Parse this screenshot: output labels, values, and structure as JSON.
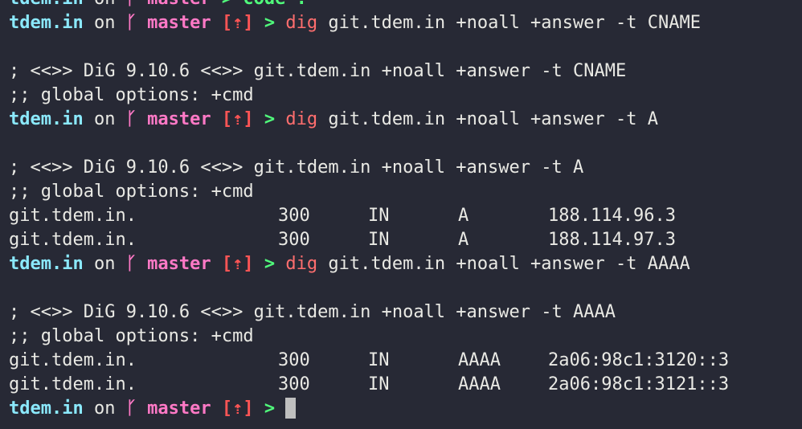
{
  "prompt": {
    "host": "tdem.in",
    "on": "on",
    "branch_icon": "git-branch-icon",
    "branch_glyph": "ᚴ",
    "branch": "master",
    "status": "[⇡]",
    "arrow": ">"
  },
  "top_partial": {
    "host": "tdem.in",
    "on": "on",
    "branch": "master",
    "rest": "> code ."
  },
  "commands": [
    {
      "cmd": "dig",
      "args": " git.tdem.in +noall +answer -t CNAME"
    },
    {
      "cmd": "dig",
      "args": " git.tdem.in +noall +answer -t A"
    },
    {
      "cmd": "dig",
      "args": " git.tdem.in +noall +answer -t AAAA"
    }
  ],
  "outputs": [
    {
      "header": "; <<>> DiG 9.10.6 <<>> git.tdem.in +noall +answer -t CNAME",
      "options": ";; global options: +cmd"
    },
    {
      "header": "; <<>> DiG 9.10.6 <<>> git.tdem.in +noall +answer -t A",
      "options": ";; global options: +cmd",
      "records": [
        {
          "name": "git.tdem.in.",
          "ttl": "300",
          "class": "IN",
          "type": "A",
          "value": "188.114.96.3"
        },
        {
          "name": "git.tdem.in.",
          "ttl": "300",
          "class": "IN",
          "type": "A",
          "value": "188.114.97.3"
        }
      ]
    },
    {
      "header": "; <<>> DiG 9.10.6 <<>> git.tdem.in +noall +answer -t AAAA",
      "options": ";; global options: +cmd",
      "records": [
        {
          "name": "git.tdem.in.",
          "ttl": "300",
          "class": "IN",
          "type": "AAAA",
          "value": "2a06:98c1:3120::3"
        },
        {
          "name": "git.tdem.in.",
          "ttl": "300",
          "class": "IN",
          "type": "AAAA",
          "value": "2a06:98c1:3121::3"
        }
      ]
    }
  ],
  "colors": {
    "background": "#272935",
    "host": "#8be9fd",
    "branch": "#ff79c6",
    "status": "#ff5555",
    "arrow": "#50fa7b",
    "command": "#ff6e6e",
    "text": "#e9e9e4",
    "cursor": "#bfbfbf"
  }
}
